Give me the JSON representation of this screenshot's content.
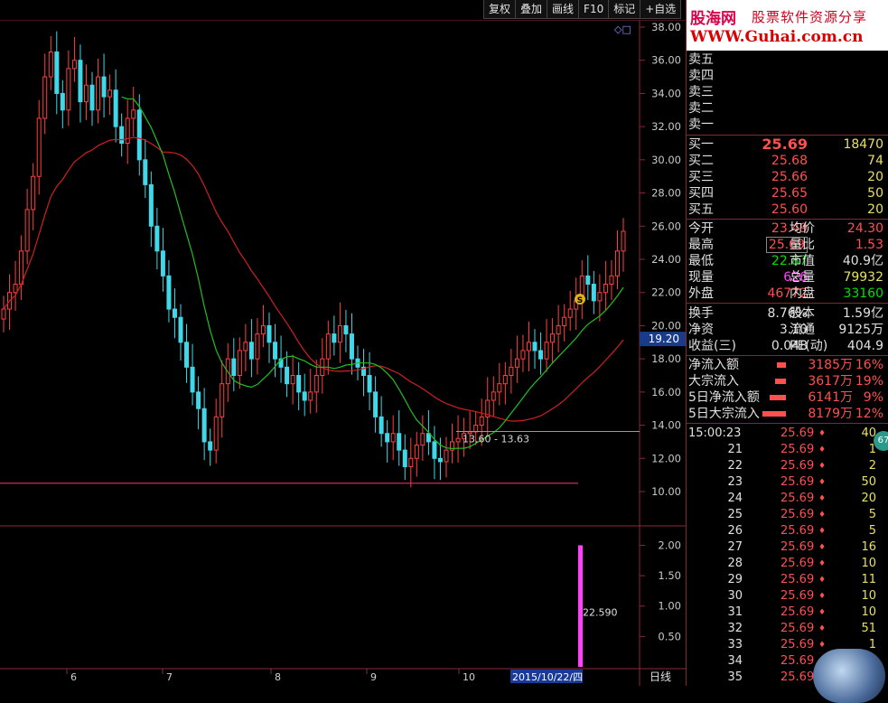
{
  "toolbar": {
    "items": [
      "复权",
      "叠加",
      "画线",
      "F10",
      "标记",
      "+自选"
    ]
  },
  "chart": {
    "y_ticks": [
      "38.00",
      "36.00",
      "34.00",
      "32.00",
      "30.00",
      "28.00",
      "26.00",
      "24.00",
      "22.00",
      "20.00",
      "18.00",
      "16.00",
      "14.00",
      "12.00",
      "10.00"
    ],
    "current_price_tag": "19.20",
    "price_range_label": "13.60 - 13.63",
    "vol_ticks": [
      "2.00",
      "1.50",
      "1.00",
      "0.50"
    ],
    "vol_value_label": "22.590",
    "x_months": [
      "6",
      "7",
      "8",
      "9",
      "10"
    ],
    "date_box": "2015/10/22/四",
    "period_label": "日线",
    "marker_s": "S",
    "top_icons": "◇□"
  },
  "chart_data": {
    "type": "candlestick",
    "ma_colors": {
      "slow": "#d02020",
      "mid": "#20c020"
    },
    "ylim": [
      10,
      38.5
    ],
    "closes": [
      21.0,
      22.0,
      22.5,
      24.5,
      27.0,
      29.0,
      32.5,
      35.0,
      36.5,
      34.0,
      33.0,
      35.5,
      36.0,
      33.5,
      34.5,
      33.0,
      35.0,
      33.8,
      34.2,
      32.0,
      31.0,
      32.5,
      33.0,
      30.0,
      28.5,
      26.0,
      24.5,
      23.0,
      21.0,
      20.5,
      19.0,
      17.5,
      16.0,
      15.0,
      13.0,
      12.5,
      14.5,
      16.5,
      18.0,
      17.0,
      18.5,
      19.0,
      18.0,
      19.5,
      20.0,
      19.0,
      18.0,
      17.5,
      16.5,
      17.0,
      16.0,
      15.5,
      16.0,
      17.0,
      18.0,
      19.5,
      19.0,
      20.0,
      19.5,
      18.0,
      17.5,
      17.0,
      16.0,
      14.5,
      13.5,
      13.0,
      13.5,
      12.5,
      11.5,
      12.0,
      12.8,
      13.5,
      13.0,
      12.0,
      11.8,
      12.5,
      13.0,
      13.2,
      13.5,
      13.6,
      14.0,
      14.5,
      15.5,
      16.0,
      16.5,
      17.0,
      17.5,
      18.0,
      18.5,
      19.0,
      18.5,
      18.0,
      19.0,
      19.5,
      20.0,
      20.5,
      21.0,
      21.5,
      23.0,
      22.5,
      21.5,
      22.0,
      22.5,
      23.0,
      24.5,
      25.69
    ],
    "volume_bar": 22.59,
    "volume_ylim": [
      0,
      2.2
    ]
  },
  "panel": {
    "logo_line1a": "股海网",
    "logo_line1b": "股票软件资源分享",
    "logo_line2": "WWW.Guhai.com.cn",
    "sells": [
      "卖五",
      "卖四",
      "卖三",
      "卖二",
      "卖一"
    ],
    "buys": [
      {
        "label": "买一",
        "price": "25.69",
        "vol": "18470"
      },
      {
        "label": "买二",
        "price": "25.68",
        "vol": "74"
      },
      {
        "label": "买三",
        "price": "25.66",
        "vol": "20"
      },
      {
        "label": "买四",
        "price": "25.65",
        "vol": "50"
      },
      {
        "label": "买五",
        "price": "25.60",
        "vol": "20"
      }
    ],
    "stats": [
      {
        "l1": "今开",
        "v1": "23.49",
        "c1": "red",
        "l2": "均价",
        "v2": "24.30",
        "c2": "red"
      },
      {
        "l1": "最高",
        "v1": "25.69",
        "c1": "red",
        "l2": "量比",
        "v2": "1.53",
        "c2": "red"
      },
      {
        "l1": "最低",
        "v1": "22.87",
        "c1": "grn",
        "l2": "市值",
        "v2": "40.9亿",
        "c2": "wht"
      },
      {
        "l1": "现量",
        "v1": "626",
        "c1": "mag",
        "l2": "总量",
        "v2": "79932",
        "c2": "yel"
      },
      {
        "l1": "外盘",
        "v1": "46772",
        "c1": "red",
        "l2": "内盘",
        "v2": "33160",
        "c2": "grn"
      }
    ],
    "stats2": [
      {
        "l1": "换手",
        "v1": "8.76%",
        "l2": "股本",
        "v2": "1.59亿"
      },
      {
        "l1": "净资",
        "v1": "3.10",
        "l2": "流通",
        "v2": "9125万"
      },
      {
        "l1": "收益(三)",
        "v1": "0.048",
        "l2": "PE(动)",
        "v2": "404.9"
      }
    ],
    "flows": [
      {
        "label": "净流入额",
        "val": "3185万",
        "pct": "16%",
        "barw": 10
      },
      {
        "label": "大宗流入",
        "val": "3617万",
        "pct": "19%",
        "barw": 12
      },
      {
        "label": "5日净流入额",
        "val": "6141万",
        "pct": "9%",
        "barw": 18
      },
      {
        "label": "5日大宗流入",
        "val": "8179万",
        "pct": "12%",
        "barw": 26
      }
    ],
    "ticks": [
      {
        "t": "15:00:23",
        "p": "25.69",
        "v": "40"
      },
      {
        "t": "21",
        "p": "25.69",
        "v": "1"
      },
      {
        "t": "22",
        "p": "25.69",
        "v": "2"
      },
      {
        "t": "23",
        "p": "25.69",
        "v": "50"
      },
      {
        "t": "24",
        "p": "25.69",
        "v": "20"
      },
      {
        "t": "25",
        "p": "25.69",
        "v": "5"
      },
      {
        "t": "26",
        "p": "25.69",
        "v": "5"
      },
      {
        "t": "27",
        "p": "25.69",
        "v": "16"
      },
      {
        "t": "28",
        "p": "25.69",
        "v": "10"
      },
      {
        "t": "29",
        "p": "25.69",
        "v": "11"
      },
      {
        "t": "30",
        "p": "25.69",
        "v": "10"
      },
      {
        "t": "31",
        "p": "25.69",
        "v": "10"
      },
      {
        "t": "32",
        "p": "25.69",
        "v": "51"
      },
      {
        "t": "33",
        "p": "25.69",
        "v": "1"
      },
      {
        "t": "34",
        "p": "25.69",
        "v": ""
      },
      {
        "t": "35",
        "p": "25.69",
        "v": ""
      }
    ],
    "tick_arrow": "♦",
    "badge": "67"
  }
}
